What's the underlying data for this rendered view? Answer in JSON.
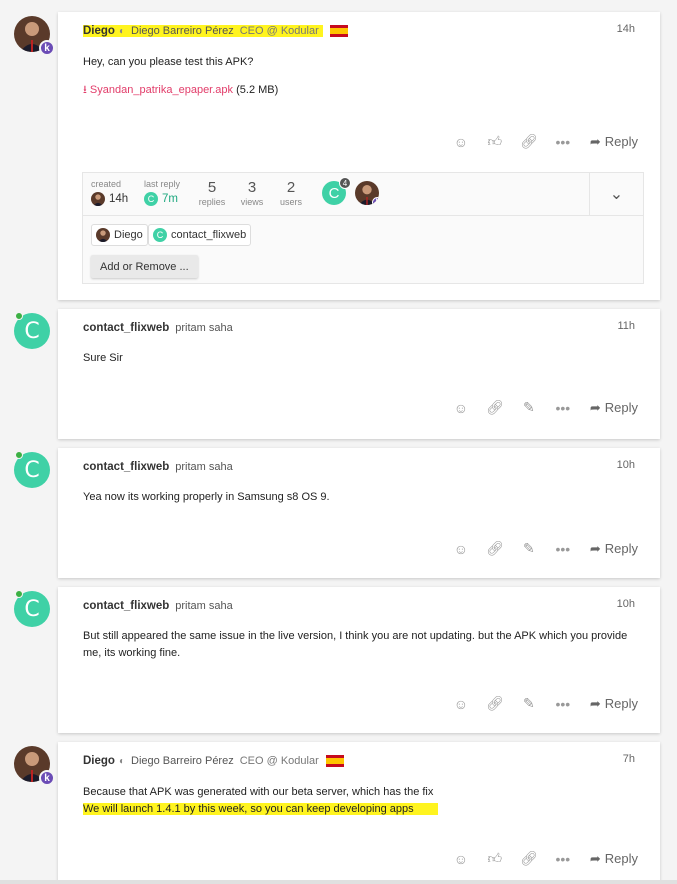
{
  "posts": [
    {
      "username": "Diego",
      "full_name": "Diego Barreiro Pérez",
      "user_title": "CEO @ Kodular",
      "time": "14h",
      "text": "Hey, can you please test this APK?",
      "attachment": {
        "name": "Syandan_patrika_epaper.apk",
        "size": "(5.2 MB)"
      },
      "reply_label": "Reply"
    },
    {
      "username": "contact_flixweb",
      "full_name": "pritam saha",
      "time": "11h",
      "text": "Sure Sir",
      "reply_label": "Reply"
    },
    {
      "username": "contact_flixweb",
      "full_name": "pritam saha",
      "time": "10h",
      "text": "Yea now its working properly in Samsung s8 OS 9.",
      "reply_label": "Reply"
    },
    {
      "username": "contact_flixweb",
      "full_name": "pritam saha",
      "time": "10h",
      "text": "But still appeared the same issue in the live version, I think you are not updating. but the APK which you provide me, its working fine.",
      "reply_label": "Reply"
    },
    {
      "username": "Diego",
      "full_name": "Diego Barreiro Pérez",
      "user_title": "CEO @ Kodular",
      "time": "7h",
      "text_line1": "Because that APK was generated with our beta server, which has the fix",
      "text_line2": "We will launch 1.4.1 by this week, so you can keep developing apps",
      "reply_label": "Reply"
    }
  ],
  "summary": {
    "created_label": "created",
    "created_time": "14h",
    "last_reply_label": "last reply",
    "last_reply_time": "7m",
    "replies_count": "5",
    "replies_label": "replies",
    "views_count": "3",
    "views_label": "views",
    "users_count": "2",
    "users_label": "users",
    "participant_post_count": "4"
  },
  "pm_users": [
    "Diego",
    "contact_flixweb"
  ],
  "add_remove_label": "Add or Remove ...",
  "avatar_letter": "C",
  "badge_letter": "k",
  "colors": {
    "teal_avatar": "#3fd1a6",
    "kodular_badge": "#6a4bb5",
    "highlight": "#fff41f",
    "attachment": "#e23d6a"
  }
}
